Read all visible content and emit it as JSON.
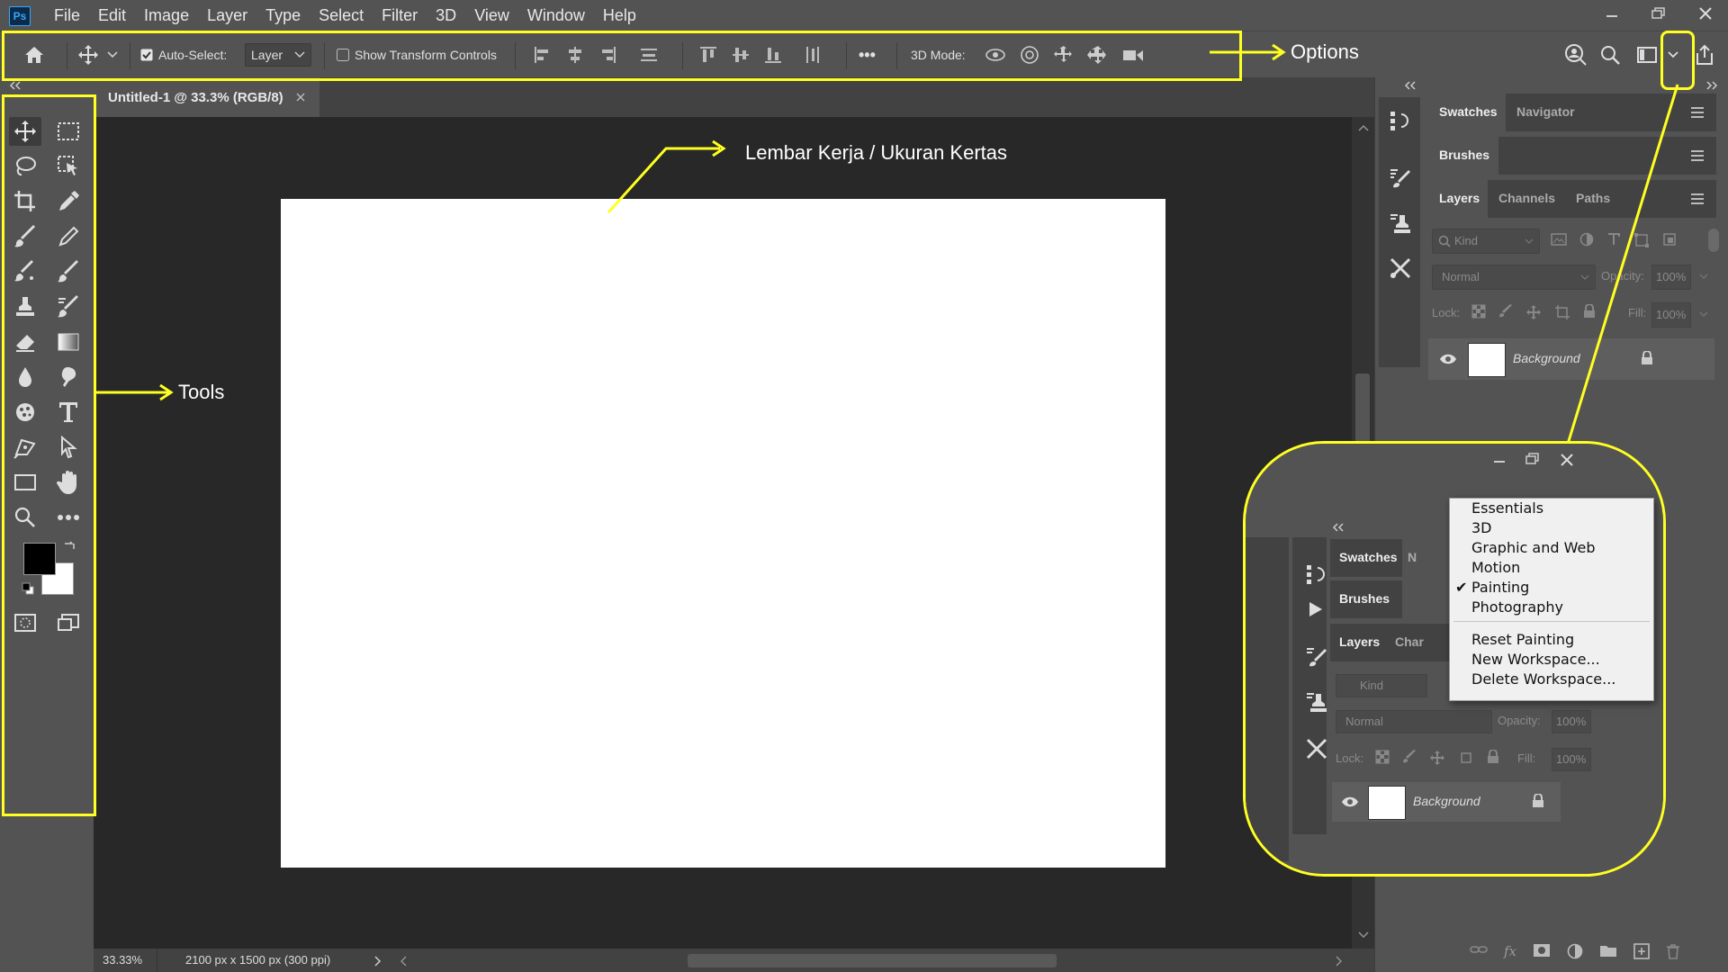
{
  "app": {
    "logo": "Ps"
  },
  "menu": [
    "File",
    "Edit",
    "Image",
    "Layer",
    "Type",
    "Select",
    "Filter",
    "3D",
    "View",
    "Window",
    "Help"
  ],
  "options": {
    "auto_select_label": "Auto-Select:",
    "auto_select_value": "Layer",
    "show_transform_label": "Show Transform Controls",
    "mode_3d_label": "3D Mode:",
    "more": "•••"
  },
  "document": {
    "tab_title": "Untitled-1 @ 33.3% (RGB/8)",
    "zoom": "33.33%",
    "doc_info": "2100 px x 1500 px (300 ppi)"
  },
  "panels": {
    "tabs_row1": [
      "Swatches",
      "Navigator"
    ],
    "tabs_row2": [
      "Brushes"
    ],
    "tabs_row3": [
      "Layers",
      "Channels",
      "Paths"
    ],
    "kind_placeholder": "Kind",
    "blend_mode": "Normal",
    "opacity_label": "Opacity:",
    "opacity_value": "100%",
    "lock_label": "Lock:",
    "fill_label": "Fill:",
    "fill_value": "100%",
    "layer_name": "Background"
  },
  "annotations": {
    "options": "Options",
    "tools": "Tools",
    "canvas": "Lembar Kerja / Ukuran Kertas"
  },
  "inset": {
    "tabs_row1": [
      "Swatches",
      "N"
    ],
    "tabs_row2": [
      "Brushes"
    ],
    "tabs_row3": [
      "Layers",
      "Char"
    ],
    "kind_placeholder": "Kind",
    "blend_mode": "Normal",
    "opacity_label": "Opacity:",
    "opacity_value": "100%",
    "lock_label": "Lock:",
    "fill_label": "Fill:",
    "fill_value": "100%",
    "layer_name": "Background",
    "workspace_menu": {
      "items": [
        "Essentials",
        "3D",
        "Graphic and Web",
        "Motion",
        "Painting",
        "Photography"
      ],
      "checked": "Painting",
      "actions": [
        "Reset Painting",
        "New Workspace...",
        "Delete Workspace..."
      ]
    }
  },
  "colors": {
    "annotation": "#ffff22",
    "ui_bg": "#535353",
    "canvas_bg": "#282828",
    "accent": "#31a8ff"
  }
}
